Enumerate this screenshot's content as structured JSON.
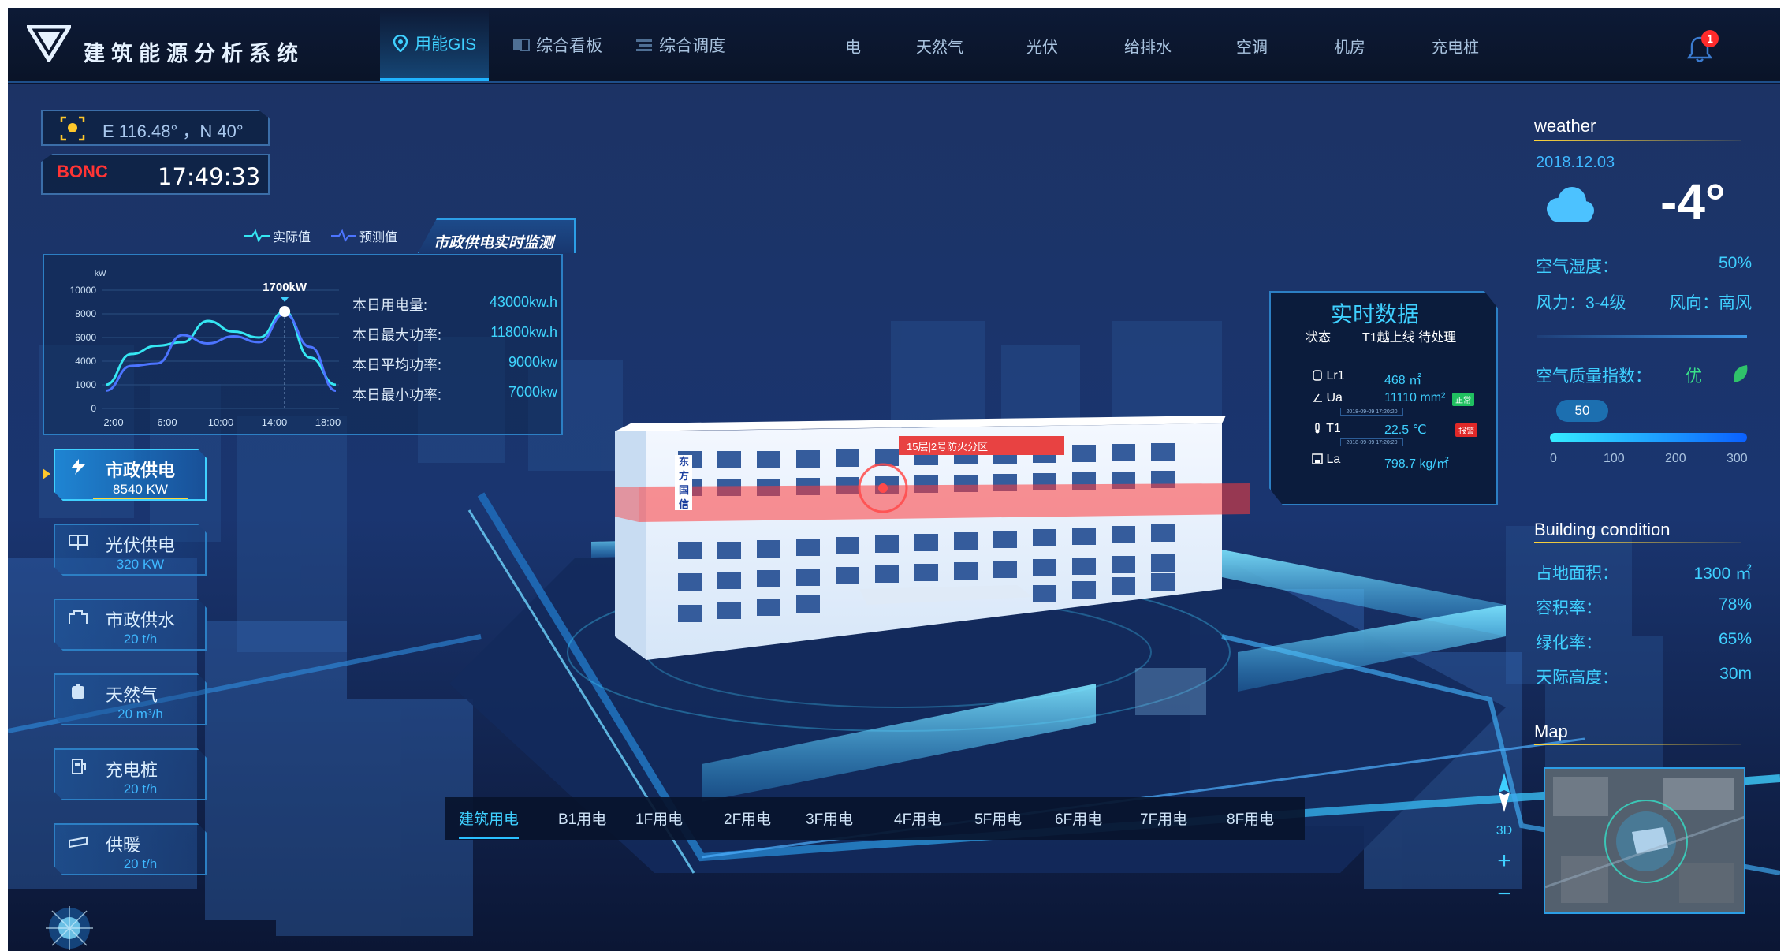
{
  "header": {
    "app_title": "建筑能源分析系统",
    "tabs": [
      {
        "label": "用能GIS",
        "active": true,
        "icon": "map-pin-icon"
      },
      {
        "label": "综合看板",
        "active": false,
        "icon": "dashboard-icon"
      },
      {
        "label": "综合调度",
        "active": false,
        "icon": "list-icon"
      }
    ],
    "categories": [
      "电",
      "天然气",
      "光伏",
      "给排水",
      "空调",
      "机房",
      "充电桩"
    ],
    "notification_count": "1"
  },
  "location": {
    "coords": "E 116.48° ，N 40°",
    "brand": "BONC",
    "time": "17:49:33"
  },
  "monitor": {
    "title": "市政供电实时监测",
    "legend_actual": "实际值",
    "legend_predict": "预测值",
    "stats": [
      {
        "label": "本日用电量:",
        "value": "43000kw.h"
      },
      {
        "label": "本日最大功率:",
        "value": "11800kw.h"
      },
      {
        "label": "本日平均功率:",
        "value": "9000kw"
      },
      {
        "label": "本日最小功率:",
        "value": "7000kw"
      }
    ]
  },
  "chart_data": {
    "type": "line",
    "ylabel": "kW",
    "ylim": [
      0,
      10000
    ],
    "yticks": [
      "10000",
      "8000",
      "6000",
      "4000",
      "1000",
      "0"
    ],
    "xticks": [
      "2:00",
      "6:00",
      "10:00",
      "14:00",
      "18:00"
    ],
    "peak_label": "1700kW",
    "series": [
      {
        "name": "实际值",
        "color": "#35e6f2",
        "values": [
          2000,
          4600,
          5300,
          5600,
          7400,
          6500,
          6000,
          8200,
          4300,
          2000
        ]
      },
      {
        "name": "预测值",
        "color": "#4c74ff",
        "values": [
          1500,
          3600,
          3800,
          6200,
          5500,
          6100,
          5600,
          8000,
          5200,
          1500
        ]
      }
    ]
  },
  "left_panel": [
    {
      "label": "市政供电",
      "value": "8540 KW",
      "icon": "lightning-icon",
      "active": true
    },
    {
      "label": "光伏供电",
      "value": "320 KW",
      "icon": "solar-panel-icon",
      "active": false
    },
    {
      "label": "市政供水",
      "value": "20  t/h",
      "icon": "water-icon",
      "active": false
    },
    {
      "label": "天然气",
      "value": "20  m³/h",
      "icon": "gas-icon",
      "active": false
    },
    {
      "label": "充电桩",
      "value": "20  t/h",
      "icon": "charger-icon",
      "active": false
    },
    {
      "label": "供暖",
      "value": "20  t/h",
      "icon": "heating-icon",
      "active": false
    }
  ],
  "building": {
    "sign": "东方国信",
    "alert": "15层|2号防火分区"
  },
  "realtime": {
    "title": "实时数据",
    "status_label": "状态",
    "status_value": "T1越上线 待处理",
    "rows": [
      {
        "name": "Lr1",
        "value": "468 ㎡",
        "icon": "cylinder-icon"
      },
      {
        "name": "Ua",
        "value": "11110 mm²",
        "icon": "gauge-icon",
        "tag": "正常",
        "tag_color": "#20c060",
        "sub": "2018-09-09  17:20:20"
      },
      {
        "name": "T1",
        "value": "22.5 ℃",
        "icon": "thermometer-icon",
        "tag": "报警",
        "tag_color": "#e02828",
        "sub": "2018-09-09  17:20:20"
      },
      {
        "name": "La",
        "value": "798.7 kg/㎡",
        "icon": "save-icon"
      }
    ]
  },
  "weather": {
    "title": "weather",
    "date": "2018.12.03",
    "temp": "-4°",
    "humidity_label": "空气湿度：",
    "humidity": "50%",
    "wind": "风力：3-4级",
    "wind_dir": "风向：南风",
    "aqi_label": "空气质量指数：",
    "aqi_level": "优",
    "aqi_value": "50",
    "aqi_ticks": [
      "0",
      "100",
      "200",
      "300"
    ]
  },
  "building_condition": {
    "title": "Building condition",
    "rows": [
      {
        "label": "占地面积：",
        "value": "1300 ㎡"
      },
      {
        "label": "容积率：",
        "value": "78%"
      },
      {
        "label": "绿化率：",
        "value": "65%"
      },
      {
        "label": "天际高度：",
        "value": "30m"
      }
    ]
  },
  "map": {
    "title": "Map",
    "view_3d": "3D",
    "zoom_in": "+",
    "zoom_out": "−"
  },
  "floors": [
    "建筑用电",
    "B1用电",
    "1F用电",
    "2F用电",
    "3F用电",
    "4F用电",
    "5F用电",
    "6F用电",
    "7F用电",
    "8F用电"
  ]
}
